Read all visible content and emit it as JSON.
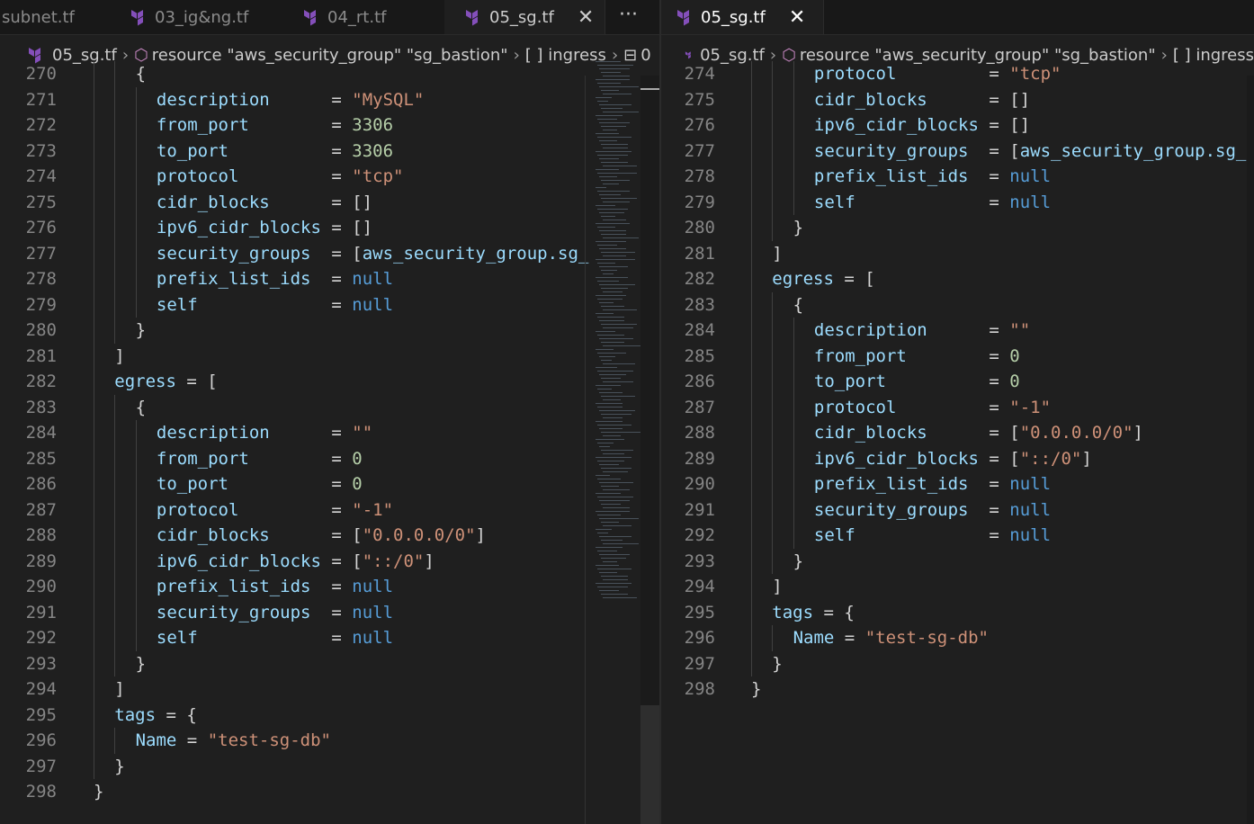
{
  "left": {
    "tabs": [
      {
        "label": "subnet.tf",
        "active": false
      },
      {
        "label": "03_ig&ng.tf",
        "active": false
      },
      {
        "label": "04_rt.tf",
        "active": false
      },
      {
        "label": "05_sg.tf",
        "active": true
      }
    ],
    "more_label": "···",
    "close_label": "✕",
    "breadcrumb": [
      "05_sg.tf",
      "resource \"aws_security_group\" \"sg_bastion\"",
      "[ ] ingress",
      "0"
    ],
    "lines": [
      {
        "n": "270",
        "i": 2,
        "t": [
          [
            "o",
            "{"
          ]
        ]
      },
      {
        "n": "271",
        "i": 3,
        "t": [
          [
            "k",
            "description      "
          ],
          [
            "o",
            "= "
          ],
          [
            "s",
            "\"MySQL\""
          ]
        ]
      },
      {
        "n": "272",
        "i": 3,
        "t": [
          [
            "k",
            "from_port        "
          ],
          [
            "o",
            "= "
          ],
          [
            "n",
            "3306"
          ]
        ]
      },
      {
        "n": "273",
        "i": 3,
        "t": [
          [
            "k",
            "to_port          "
          ],
          [
            "o",
            "= "
          ],
          [
            "n",
            "3306"
          ]
        ]
      },
      {
        "n": "274",
        "i": 3,
        "t": [
          [
            "k",
            "protocol         "
          ],
          [
            "o",
            "= "
          ],
          [
            "s",
            "\"tcp\""
          ]
        ]
      },
      {
        "n": "275",
        "i": 3,
        "t": [
          [
            "k",
            "cidr_blocks      "
          ],
          [
            "o",
            "= []"
          ]
        ]
      },
      {
        "n": "276",
        "i": 3,
        "t": [
          [
            "k",
            "ipv6_cidr_blocks "
          ],
          [
            "o",
            "= []"
          ]
        ]
      },
      {
        "n": "277",
        "i": 3,
        "t": [
          [
            "k",
            "security_groups  "
          ],
          [
            "o",
            "= ["
          ],
          [
            "k",
            "aws_security_group.sg_"
          ]
        ]
      },
      {
        "n": "278",
        "i": 3,
        "t": [
          [
            "k",
            "prefix_list_ids  "
          ],
          [
            "o",
            "= "
          ],
          [
            "kw",
            "null"
          ]
        ]
      },
      {
        "n": "279",
        "i": 3,
        "t": [
          [
            "k",
            "self             "
          ],
          [
            "o",
            "= "
          ],
          [
            "kw",
            "null"
          ]
        ]
      },
      {
        "n": "280",
        "i": 2,
        "t": [
          [
            "o",
            "}"
          ]
        ]
      },
      {
        "n": "281",
        "i": 1,
        "t": [
          [
            "o",
            "]"
          ]
        ]
      },
      {
        "n": "282",
        "i": 1,
        "t": [
          [
            "k",
            "egress "
          ],
          [
            "o",
            "= ["
          ]
        ]
      },
      {
        "n": "283",
        "i": 2,
        "t": [
          [
            "o",
            "{"
          ]
        ]
      },
      {
        "n": "284",
        "i": 3,
        "t": [
          [
            "k",
            "description      "
          ],
          [
            "o",
            "= "
          ],
          [
            "s",
            "\"\""
          ]
        ]
      },
      {
        "n": "285",
        "i": 3,
        "t": [
          [
            "k",
            "from_port        "
          ],
          [
            "o",
            "= "
          ],
          [
            "n",
            "0"
          ]
        ]
      },
      {
        "n": "286",
        "i": 3,
        "t": [
          [
            "k",
            "to_port          "
          ],
          [
            "o",
            "= "
          ],
          [
            "n",
            "0"
          ]
        ]
      },
      {
        "n": "287",
        "i": 3,
        "t": [
          [
            "k",
            "protocol         "
          ],
          [
            "o",
            "= "
          ],
          [
            "s",
            "\"-1\""
          ]
        ]
      },
      {
        "n": "288",
        "i": 3,
        "t": [
          [
            "k",
            "cidr_blocks      "
          ],
          [
            "o",
            "= ["
          ],
          [
            "s",
            "\"0.0.0.0/0\""
          ],
          [
            "o",
            "]"
          ]
        ]
      },
      {
        "n": "289",
        "i": 3,
        "t": [
          [
            "k",
            "ipv6_cidr_blocks "
          ],
          [
            "o",
            "= ["
          ],
          [
            "s",
            "\"::/0\""
          ],
          [
            "o",
            "]"
          ]
        ]
      },
      {
        "n": "290",
        "i": 3,
        "t": [
          [
            "k",
            "prefix_list_ids  "
          ],
          [
            "o",
            "= "
          ],
          [
            "kw",
            "null"
          ]
        ]
      },
      {
        "n": "291",
        "i": 3,
        "t": [
          [
            "k",
            "security_groups  "
          ],
          [
            "o",
            "= "
          ],
          [
            "kw",
            "null"
          ]
        ]
      },
      {
        "n": "292",
        "i": 3,
        "t": [
          [
            "k",
            "self             "
          ],
          [
            "o",
            "= "
          ],
          [
            "kw",
            "null"
          ]
        ]
      },
      {
        "n": "293",
        "i": 2,
        "t": [
          [
            "o",
            "}"
          ]
        ]
      },
      {
        "n": "294",
        "i": 1,
        "t": [
          [
            "o",
            "]"
          ]
        ]
      },
      {
        "n": "295",
        "i": 1,
        "t": [
          [
            "k",
            "tags "
          ],
          [
            "o",
            "= {"
          ]
        ]
      },
      {
        "n": "296",
        "i": 2,
        "t": [
          [
            "k",
            "Name "
          ],
          [
            "o",
            "= "
          ],
          [
            "s",
            "\"test-sg-db\""
          ]
        ]
      },
      {
        "n": "297",
        "i": 1,
        "t": [
          [
            "o",
            "}"
          ]
        ]
      },
      {
        "n": "298",
        "i": 0,
        "t": [
          [
            "o",
            "}"
          ]
        ]
      }
    ]
  },
  "right": {
    "tab": {
      "label": "05_sg.tf",
      "active": true
    },
    "close_label": "✕",
    "breadcrumb": [
      "05_sg.tf",
      "resource \"aws_security_group\" \"sg_bastion\"",
      "[ ] ingress"
    ],
    "lines": [
      {
        "n": "274",
        "i": 3,
        "t": [
          [
            "k",
            "protocol         "
          ],
          [
            "o",
            "= "
          ],
          [
            "s",
            "\"tcp\""
          ]
        ]
      },
      {
        "n": "275",
        "i": 3,
        "t": [
          [
            "k",
            "cidr_blocks      "
          ],
          [
            "o",
            "= []"
          ]
        ]
      },
      {
        "n": "276",
        "i": 3,
        "t": [
          [
            "k",
            "ipv6_cidr_blocks "
          ],
          [
            "o",
            "= []"
          ]
        ]
      },
      {
        "n": "277",
        "i": 3,
        "t": [
          [
            "k",
            "security_groups  "
          ],
          [
            "o",
            "= ["
          ],
          [
            "k",
            "aws_security_group.sg_"
          ]
        ]
      },
      {
        "n": "278",
        "i": 3,
        "t": [
          [
            "k",
            "prefix_list_ids  "
          ],
          [
            "o",
            "= "
          ],
          [
            "kw",
            "null"
          ]
        ]
      },
      {
        "n": "279",
        "i": 3,
        "t": [
          [
            "k",
            "self             "
          ],
          [
            "o",
            "= "
          ],
          [
            "kw",
            "null"
          ]
        ]
      },
      {
        "n": "280",
        "i": 2,
        "t": [
          [
            "o",
            "}"
          ]
        ]
      },
      {
        "n": "281",
        "i": 1,
        "t": [
          [
            "o",
            "]"
          ]
        ]
      },
      {
        "n": "282",
        "i": 1,
        "t": [
          [
            "k",
            "egress "
          ],
          [
            "o",
            "= ["
          ]
        ]
      },
      {
        "n": "283",
        "i": 2,
        "t": [
          [
            "o",
            "{"
          ]
        ]
      },
      {
        "n": "284",
        "i": 3,
        "t": [
          [
            "k",
            "description      "
          ],
          [
            "o",
            "= "
          ],
          [
            "s",
            "\"\""
          ]
        ]
      },
      {
        "n": "285",
        "i": 3,
        "t": [
          [
            "k",
            "from_port        "
          ],
          [
            "o",
            "= "
          ],
          [
            "n",
            "0"
          ]
        ]
      },
      {
        "n": "286",
        "i": 3,
        "t": [
          [
            "k",
            "to_port          "
          ],
          [
            "o",
            "= "
          ],
          [
            "n",
            "0"
          ]
        ]
      },
      {
        "n": "287",
        "i": 3,
        "t": [
          [
            "k",
            "protocol         "
          ],
          [
            "o",
            "= "
          ],
          [
            "s",
            "\"-1\""
          ]
        ]
      },
      {
        "n": "288",
        "i": 3,
        "t": [
          [
            "k",
            "cidr_blocks      "
          ],
          [
            "o",
            "= ["
          ],
          [
            "s",
            "\"0.0.0.0/0\""
          ],
          [
            "o",
            "]"
          ]
        ]
      },
      {
        "n": "289",
        "i": 3,
        "t": [
          [
            "k",
            "ipv6_cidr_blocks "
          ],
          [
            "o",
            "= ["
          ],
          [
            "s",
            "\"::/0\""
          ],
          [
            "o",
            "]"
          ]
        ]
      },
      {
        "n": "290",
        "i": 3,
        "t": [
          [
            "k",
            "prefix_list_ids  "
          ],
          [
            "o",
            "= "
          ],
          [
            "kw",
            "null"
          ]
        ]
      },
      {
        "n": "291",
        "i": 3,
        "t": [
          [
            "k",
            "security_groups  "
          ],
          [
            "o",
            "= "
          ],
          [
            "kw",
            "null"
          ]
        ]
      },
      {
        "n": "292",
        "i": 3,
        "t": [
          [
            "k",
            "self             "
          ],
          [
            "o",
            "= "
          ],
          [
            "kw",
            "null"
          ]
        ]
      },
      {
        "n": "293",
        "i": 2,
        "t": [
          [
            "o",
            "}"
          ]
        ]
      },
      {
        "n": "294",
        "i": 1,
        "t": [
          [
            "o",
            "]"
          ]
        ]
      },
      {
        "n": "295",
        "i": 1,
        "t": [
          [
            "k",
            "tags "
          ],
          [
            "o",
            "= {"
          ]
        ]
      },
      {
        "n": "296",
        "i": 2,
        "t": [
          [
            "k",
            "Name "
          ],
          [
            "o",
            "= "
          ],
          [
            "s",
            "\"test-sg-db\""
          ]
        ]
      },
      {
        "n": "297",
        "i": 1,
        "t": [
          [
            "o",
            "}"
          ]
        ]
      },
      {
        "n": "298",
        "i": 0,
        "t": [
          [
            "o",
            "}"
          ]
        ]
      }
    ]
  }
}
